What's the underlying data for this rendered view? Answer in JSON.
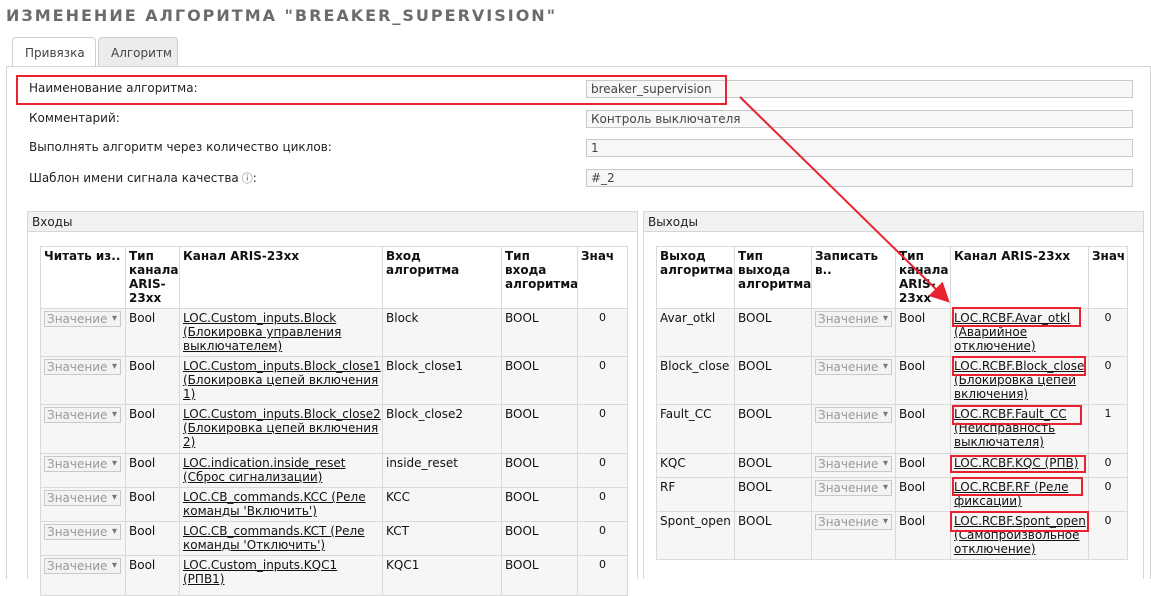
{
  "page": {
    "title": "ИЗМЕНЕНИЕ АЛГОРИТМА \"BREAKER_SUPERVISION\""
  },
  "tabs": [
    {
      "label": "Привязка",
      "active": true
    },
    {
      "label": "Алгоритм",
      "active": false
    }
  ],
  "form": {
    "name_label": "Наименование алгоритма:",
    "name_value": "breaker_supervision",
    "comment_label": "Комментарий:",
    "comment_value": "Контроль выключателя",
    "cycles_label": "Выполнять алгоритм через количество циклов:",
    "cycles_value": "1",
    "quality_label": "Шаблон имени сигнала качества",
    "quality_value": "#_2"
  },
  "inputs": {
    "section_title": "Входы",
    "headers": {
      "read_from": "Читать из..",
      "channel_type": "Тип канала ARIS-23xx",
      "channel": "Канал ARIS-23xx",
      "alg_input": "Вход алгоритма",
      "alg_input_type": "Тип входа алгоритма",
      "value": "Знач"
    },
    "rows": [
      {
        "read_from": "Значение",
        "channel_type": "Bool",
        "channel": "LOC.Custom_inputs.Block (Блокировка управления выключателем)",
        "alg_input": "Block",
        "alg_input_type": "BOOL",
        "value": "0"
      },
      {
        "read_from": "Значение",
        "channel_type": "Bool",
        "channel": "LOC.Custom_inputs.Block_close1 (Блокировка цепей включения 1)",
        "alg_input": "Block_close1",
        "alg_input_type": "BOOL",
        "value": "0"
      },
      {
        "read_from": "Значение",
        "channel_type": "Bool",
        "channel": "LOC.Custom_inputs.Block_close2 (Блокировка цепей включения 2)",
        "alg_input": "Block_close2",
        "alg_input_type": "BOOL",
        "value": "0"
      },
      {
        "read_from": "Значение",
        "channel_type": "Bool",
        "channel": "LOC.indication.inside_reset (Сброс сигнализации)",
        "alg_input": "inside_reset",
        "alg_input_type": "BOOL",
        "value": "0"
      },
      {
        "read_from": "Значение",
        "channel_type": "Bool",
        "channel": "LOC.CB_commands.KCC (Реле команды 'Включить')",
        "alg_input": "KCC",
        "alg_input_type": "BOOL",
        "value": "0"
      },
      {
        "read_from": "Значение",
        "channel_type": "Bool",
        "channel": "LOC.CB_commands.KCT (Реле команды 'Отключить')",
        "alg_input": "KCT",
        "alg_input_type": "BOOL",
        "value": "0"
      },
      {
        "read_from": "Значение",
        "channel_type": "Bool",
        "channel": "LOC.Custom_inputs.KQC1 (РПВ1)",
        "alg_input": "KQC1",
        "alg_input_type": "BOOL",
        "value": "0"
      }
    ]
  },
  "outputs": {
    "section_title": "Выходы",
    "headers": {
      "alg_output": "Выход алгоритма",
      "alg_output_type": "Тип выхода алгоритма",
      "write_to": "Записать в..",
      "channel_type": "Тип канала ARIS-23xx",
      "channel": "Канал ARIS-23xx",
      "value": "Знач"
    },
    "rows": [
      {
        "alg_output": "Avar_otkl",
        "alg_output_type": "BOOL",
        "write_to": "Значение",
        "channel_type": "Bool",
        "channel_code": "LOC.RCBF.Avar_otkl",
        "channel_desc": " (Аварийное отключение)",
        "value": "0"
      },
      {
        "alg_output": "Block_close",
        "alg_output_type": "BOOL",
        "write_to": "Значение",
        "channel_type": "Bool",
        "channel_code": "LOC.RCBF.Block_close",
        "channel_desc": " (Блокировка цепей включения)",
        "value": "0"
      },
      {
        "alg_output": "Fault_CC",
        "alg_output_type": "BOOL",
        "write_to": "Значение",
        "channel_type": "Bool",
        "channel_code": "LOC.RCBF.Fault_CC",
        "channel_desc": " (Неисправность выключателя)",
        "value": "1"
      },
      {
        "alg_output": "KQC",
        "alg_output_type": "BOOL",
        "write_to": "Значение",
        "channel_type": "Bool",
        "channel_code": "LOC.RCBF.KQC (РПВ)",
        "channel_desc": "",
        "value": "0"
      },
      {
        "alg_output": "RF",
        "alg_output_type": "BOOL",
        "write_to": "Значение",
        "channel_type": "Bool",
        "channel_code": "LOC.RCBF.RF (Реле",
        "channel_desc": " фиксации)",
        "value": "0"
      },
      {
        "alg_output": "Spont_open",
        "alg_output_type": "BOOL",
        "write_to": "Значение",
        "channel_type": "Bool",
        "channel_code": "LOC.RCBF.Spont_open",
        "channel_desc": " (Самопроизвольное отключение)",
        "value": "0"
      }
    ]
  },
  "colors": {
    "highlight": "#e8232f",
    "title": "#6b6b6b"
  }
}
